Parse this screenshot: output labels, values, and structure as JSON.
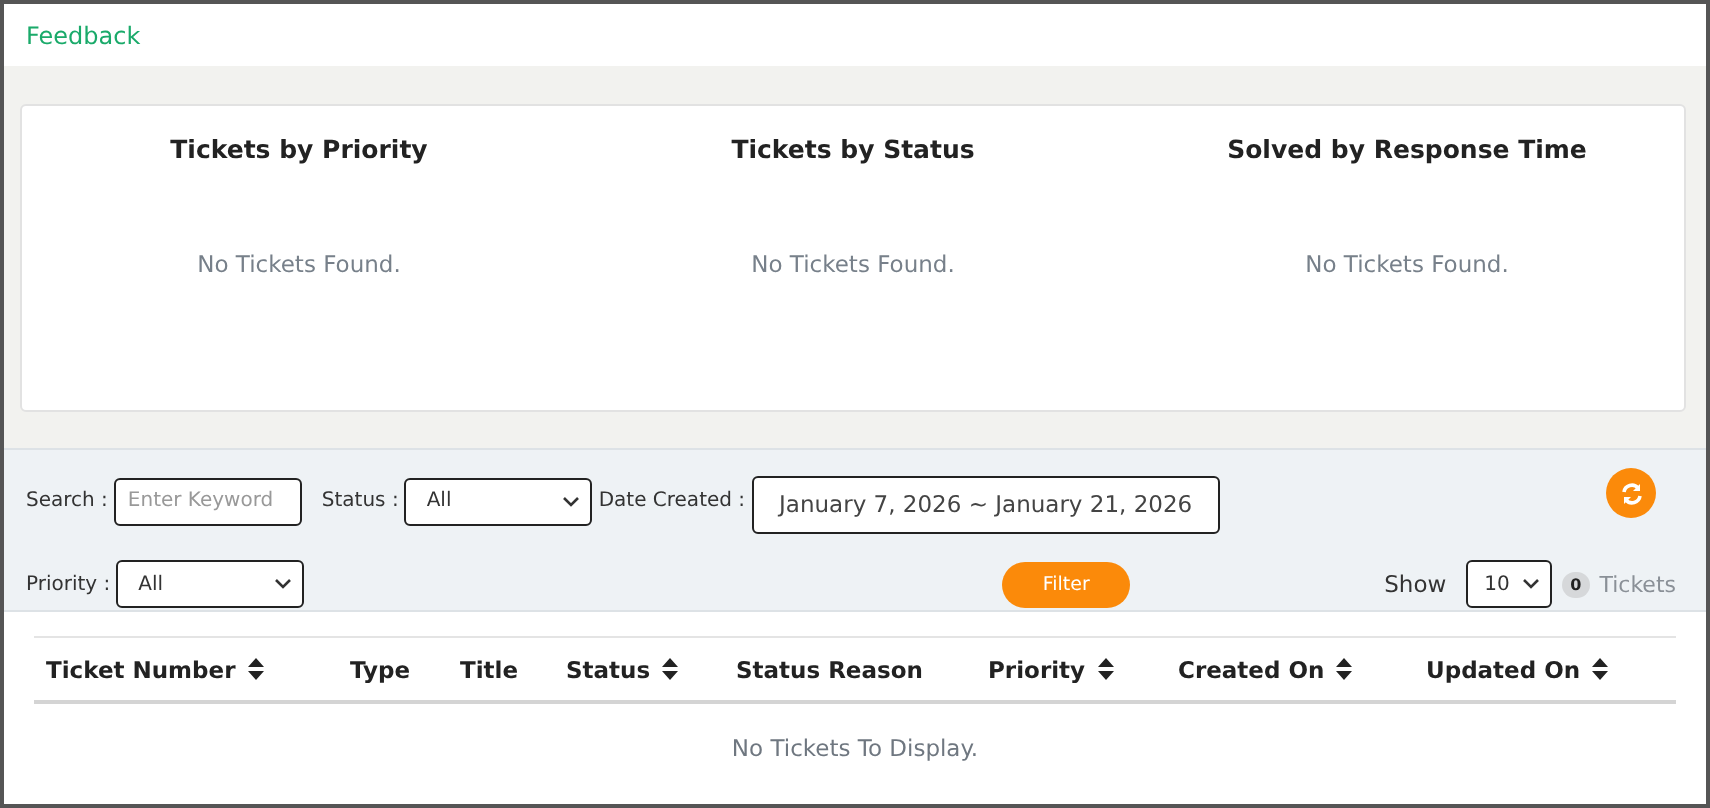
{
  "header": {
    "title": "Feedback"
  },
  "summary_cards": [
    {
      "title": "Tickets by Priority",
      "empty_text": "No Tickets Found."
    },
    {
      "title": "Tickets by Status",
      "empty_text": "No Tickets Found."
    },
    {
      "title": "Solved by Response Time",
      "empty_text": "No Tickets Found."
    }
  ],
  "filters": {
    "search": {
      "label": "Search :",
      "placeholder": "Enter Keyword"
    },
    "status": {
      "label": "Status :",
      "value": "All"
    },
    "date_created": {
      "label": "Date Created :",
      "value": "January 7, 2026 ~ January 21, 2026"
    },
    "priority": {
      "label": "Priority :",
      "value": "All"
    },
    "filter_button": "Filter",
    "show": {
      "label": "Show",
      "value": "10"
    },
    "count": {
      "value": "0",
      "label": "Tickets"
    }
  },
  "table": {
    "columns": [
      {
        "label": "Ticket Number",
        "sortable": true
      },
      {
        "label": "Type",
        "sortable": false
      },
      {
        "label": "Title",
        "sortable": false
      },
      {
        "label": "Status",
        "sortable": true
      },
      {
        "label": "Status Reason",
        "sortable": false
      },
      {
        "label": "Priority",
        "sortable": true
      },
      {
        "label": "Created On",
        "sortable": true
      },
      {
        "label": "Updated On",
        "sortable": true
      }
    ],
    "empty_text": "No Tickets To Display."
  }
}
